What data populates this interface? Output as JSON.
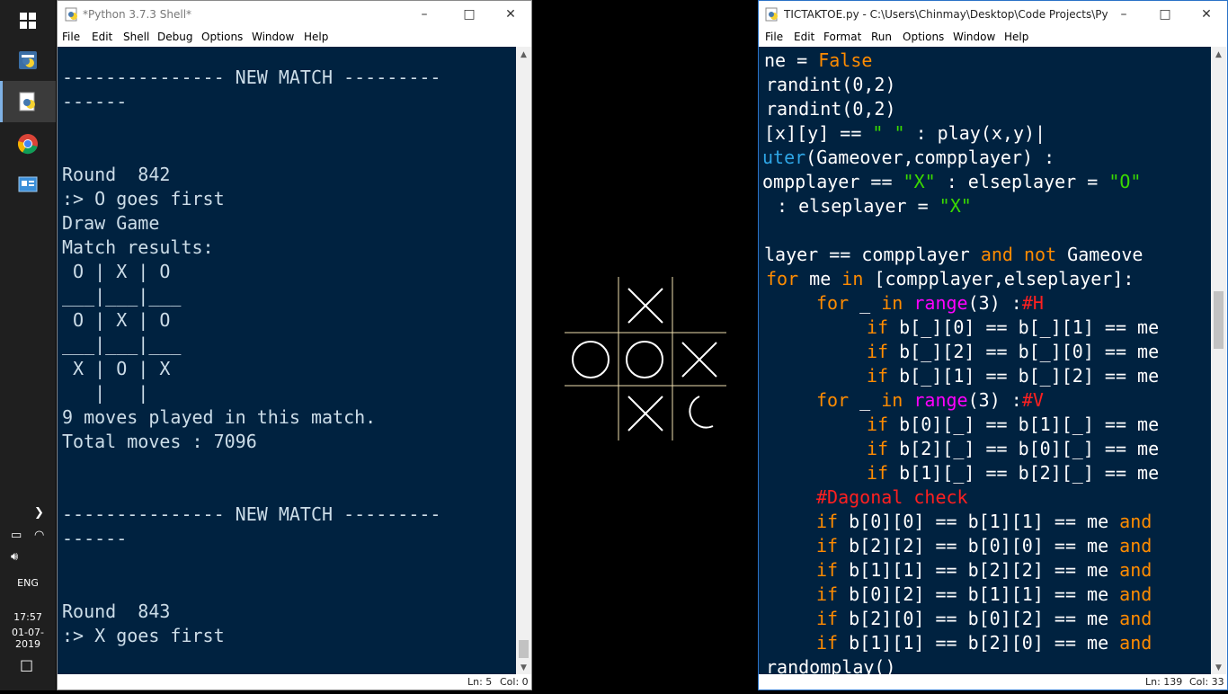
{
  "taskbar": {
    "icons": [
      "windows-start-icon",
      "python-idle-icon",
      "python-editor-icon",
      "chrome-icon",
      "control-panel-icon"
    ],
    "tray": {
      "language": "ENG",
      "time": "17:57",
      "date": "01-07-2019"
    }
  },
  "shell": {
    "title": "*Python 3.7.3 Shell*",
    "menu": [
      "File",
      "Edit",
      "Shell",
      "Debug",
      "Options",
      "Window",
      "Help"
    ],
    "lines": [
      "--------------- NEW MATCH ---------",
      "------",
      "",
      "",
      "Round  842",
      ":> O goes first",
      "Draw Game",
      "Match results:",
      " O | X | O",
      "___|___|___",
      " O | X | O",
      "___|___|___",
      " X | O | X",
      "   |   |",
      "9 moves played in this match.",
      "Total moves : 7096",
      "",
      "",
      "--------------- NEW MATCH ---------",
      "------",
      "",
      "",
      "Round  843",
      ":> X goes first"
    ],
    "status": {
      "ln": "Ln: 5",
      "col": "Col: 0"
    }
  },
  "board": {
    "cells": [
      "",
      "X",
      "",
      "O",
      "O",
      "X",
      "",
      "X",
      "O-partial"
    ],
    "line_color": "#f0e0b0",
    "mark_color": "#ffffff"
  },
  "editor": {
    "title": "TICTAKTOE.py - C:\\Users\\Chinmay\\Desktop\\Code Projects\\Pyth...",
    "menu": [
      "File",
      "Edit",
      "Format",
      "Run",
      "Options",
      "Window",
      "Help"
    ],
    "status": {
      "ln": "Ln: 139",
      "col": "Col: 33"
    },
    "code": {
      "l1a": "ne = ",
      "l1b": "False",
      "l2": "randint(0,2)",
      "l3": "randint(0,2)",
      "l4a": "[x][y] == ",
      "l4b": "\" \"",
      "l4c": " : play(x,y)",
      "l5a": "uter",
      "l5b": "(Gameover,compplayer) :",
      "l6a": "ompplayer == ",
      "l6b": "\"X\"",
      "l6c": " : elseplayer = ",
      "l6d": "\"O\"",
      "l7a": " : elseplayer = ",
      "l7b": "\"X\"",
      "l9a": "layer == compplayer ",
      "l9b": "and not",
      "l9c": " Gameove",
      "l10a": "for",
      "l10b": " me ",
      "l10c": "in",
      "l10d": " [compplayer,elseplayer]:",
      "l11a": "for",
      "l11b": " _ ",
      "l11c": "in",
      "l11d": "range",
      "l11e": "(3) :",
      "l11f": "#H",
      "l12a": "if",
      "l12b": " b[_][0] == b[_][1] == me",
      "l13a": "if",
      "l13b": " b[_][2] == b[_][0] == me",
      "l14a": "if",
      "l14b": " b[_][1] == b[_][2] == me",
      "l15a": "for",
      "l15b": " _ ",
      "l15c": "in",
      "l15d": "range",
      "l15e": "(3) :",
      "l15f": "#V",
      "l16a": "if",
      "l16b": " b[0][_] == b[1][_] == me",
      "l17a": "if",
      "l17b": " b[2][_] == b[0][_] == me",
      "l18a": "if",
      "l18b": " b[1][_] == b[2][_] == me",
      "l19": "#Dagonal check",
      "l20a": "if",
      "l20b": " b[0][0] == b[1][1] == me ",
      "l20c": "and",
      "l21a": "if",
      "l21b": " b[2][2] == b[0][0] == me ",
      "l21c": "and",
      "l22a": "if",
      "l22b": " b[1][1] == b[2][2] == me ",
      "l22c": "and",
      "l23a": "if",
      "l23b": " b[0][2] == b[1][1] == me ",
      "l23c": "and",
      "l24a": "if",
      "l24b": " b[2][0] == b[0][2] == me ",
      "l24c": "and",
      "l25a": "if",
      "l25b": " b[1][1] == b[2][0] == me ",
      "l25c": "and",
      "l26": "randomplay()"
    }
  }
}
